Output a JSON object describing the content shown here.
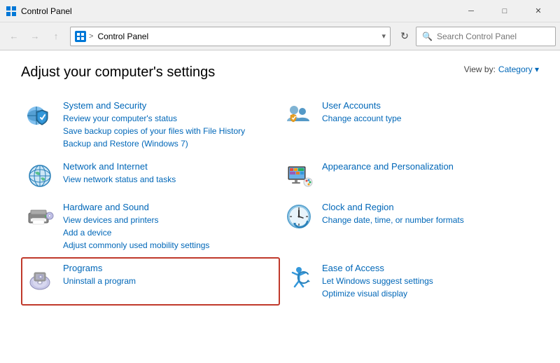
{
  "window": {
    "title": "Control Panel",
    "title_icon": "CP",
    "minimize_label": "─",
    "maximize_label": "□",
    "close_label": "✕"
  },
  "navbar": {
    "back_disabled": true,
    "forward_disabled": true,
    "up_label": "↑",
    "address_icon": "CP",
    "address_text": "Control Panel",
    "address_arrow": "▾",
    "refresh_label": "↻",
    "search_placeholder": "Search Control Panel"
  },
  "content": {
    "title": "Adjust your computer's settings",
    "view_by_label": "View by:",
    "view_by_value": "Category",
    "view_by_arrow": "▾"
  },
  "items": [
    {
      "id": "system-security",
      "title": "System and Security",
      "links": [
        "Review your computer's status",
        "Save backup copies of your files with File History",
        "Backup and Restore (Windows 7)"
      ],
      "highlighted": false
    },
    {
      "id": "user-accounts",
      "title": "User Accounts",
      "links": [
        "Change account type"
      ],
      "highlighted": false
    },
    {
      "id": "network-internet",
      "title": "Network and Internet",
      "links": [
        "View network status and tasks"
      ],
      "highlighted": false
    },
    {
      "id": "appearance",
      "title": "Appearance and Personalization",
      "links": [],
      "highlighted": false
    },
    {
      "id": "hardware-sound",
      "title": "Hardware and Sound",
      "links": [
        "View devices and printers",
        "Add a device",
        "Adjust commonly used mobility settings"
      ],
      "highlighted": false
    },
    {
      "id": "clock-region",
      "title": "Clock and Region",
      "links": [
        "Change date, time, or number formats"
      ],
      "highlighted": false
    },
    {
      "id": "programs",
      "title": "Programs",
      "links": [
        "Uninstall a program"
      ],
      "highlighted": true
    },
    {
      "id": "ease-of-access",
      "title": "Ease of Access",
      "links": [
        "Let Windows suggest settings",
        "Optimize visual display"
      ],
      "highlighted": false
    }
  ]
}
